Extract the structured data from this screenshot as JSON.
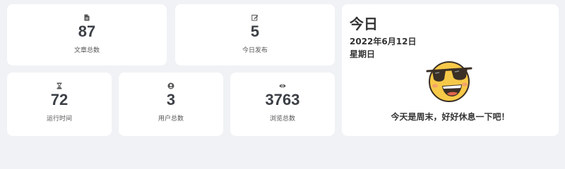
{
  "stats": [
    {
      "icon": "document-icon",
      "value": "87",
      "label": "文章总数"
    },
    {
      "icon": "edit-icon",
      "value": "5",
      "label": "今日发布"
    },
    {
      "icon": "hourglass-icon",
      "value": "72",
      "label": "运行时间"
    },
    {
      "icon": "user-icon",
      "value": "3",
      "label": "用户总数"
    },
    {
      "icon": "eye-icon",
      "value": "3763",
      "label": "浏览总数"
    }
  ],
  "today": {
    "title": "今日",
    "date": "2022年6月12日",
    "weekday": "星期日",
    "emoji": "sunglasses-face-icon",
    "message": "今天是周末，好好休息一下吧！"
  },
  "colors": {
    "background": "#f0f2f5",
    "card": "#ffffff",
    "emoji_face": "#f7c948"
  }
}
